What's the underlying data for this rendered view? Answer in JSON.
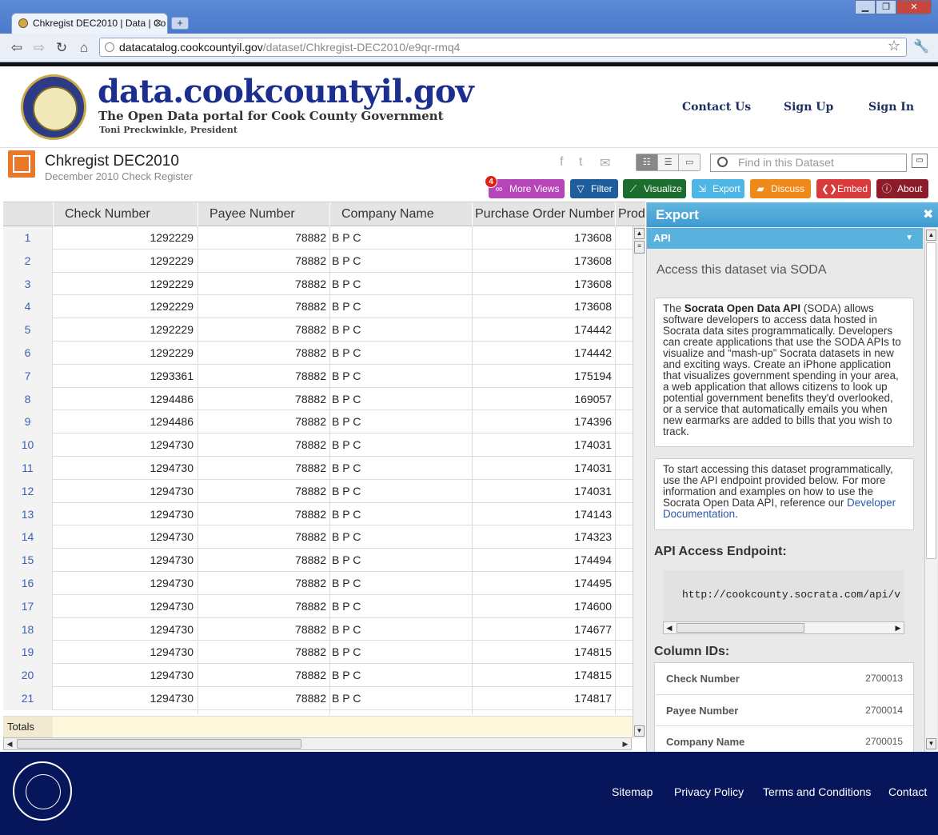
{
  "browser": {
    "tab_title": "Chkregist DEC2010 | Data | Co",
    "url_domain": "datacatalog.cookcountyil.gov",
    "url_path": "/dataset/Chkregist-DEC2010/e9qr-rmq4"
  },
  "site": {
    "name": "data.cookcountyil.gov",
    "tagline": "The Open Data portal for Cook County Government",
    "subline": "Toni Preckwinkle, President",
    "links": [
      "Contact Us",
      "Sign Up",
      "Sign In"
    ]
  },
  "dataset": {
    "title": "Chkregist DEC2010",
    "subtitle": "December 2010 Check Register",
    "search_placeholder": "Find in this Dataset",
    "more_views_count": "4",
    "actions": [
      {
        "label": "More Views",
        "color": "#b545b8"
      },
      {
        "label": "Filter",
        "color": "#1f5e9c"
      },
      {
        "label": "Visualize",
        "color": "#1b6e2e"
      },
      {
        "label": "Export",
        "color": "#4db6e4"
      },
      {
        "label": "Discuss",
        "color": "#ef8a1a"
      },
      {
        "label": "Embed",
        "color": "#d93a3a"
      },
      {
        "label": "About",
        "color": "#8c1c2a"
      }
    ]
  },
  "grid": {
    "columns": [
      "Check Number",
      "Payee Number",
      "Company Name",
      "Purchase Order Number",
      "Prod"
    ],
    "rows": [
      [
        "1",
        "1292229",
        "78882",
        "B P C",
        "173608"
      ],
      [
        "2",
        "1292229",
        "78882",
        "B P C",
        "173608"
      ],
      [
        "3",
        "1292229",
        "78882",
        "B P C",
        "173608"
      ],
      [
        "4",
        "1292229",
        "78882",
        "B P C",
        "173608"
      ],
      [
        "5",
        "1292229",
        "78882",
        "B P C",
        "174442"
      ],
      [
        "6",
        "1292229",
        "78882",
        "B P C",
        "174442"
      ],
      [
        "7",
        "1293361",
        "78882",
        "B P C",
        "175194"
      ],
      [
        "8",
        "1294486",
        "78882",
        "B P C",
        "169057"
      ],
      [
        "9",
        "1294486",
        "78882",
        "B P C",
        "174396"
      ],
      [
        "10",
        "1294730",
        "78882",
        "B P C",
        "174031"
      ],
      [
        "11",
        "1294730",
        "78882",
        "B P C",
        "174031"
      ],
      [
        "12",
        "1294730",
        "78882",
        "B P C",
        "174031"
      ],
      [
        "13",
        "1294730",
        "78882",
        "B P C",
        "174143"
      ],
      [
        "14",
        "1294730",
        "78882",
        "B P C",
        "174323"
      ],
      [
        "15",
        "1294730",
        "78882",
        "B P C",
        "174494"
      ],
      [
        "16",
        "1294730",
        "78882",
        "B P C",
        "174495"
      ],
      [
        "17",
        "1294730",
        "78882",
        "B P C",
        "174600"
      ],
      [
        "18",
        "1294730",
        "78882",
        "B P C",
        "174677"
      ],
      [
        "19",
        "1294730",
        "78882",
        "B P C",
        "174815"
      ],
      [
        "20",
        "1294730",
        "78882",
        "B P C",
        "174815"
      ],
      [
        "21",
        "1294730",
        "78882",
        "B P C",
        "174817"
      ]
    ],
    "totals_label": "Totals"
  },
  "panel": {
    "title": "Export",
    "section": "API",
    "access_heading": "Access this dataset via SODA",
    "soda_pre": "The ",
    "soda_bold": "Socrata Open Data API",
    "soda_post": " (SODA) allows software developers to access data hosted in Socrata data sites programmatically. Developers can create applications that use the SODA APIs to visualize and “mash-up” Socrata datasets in new and exciting ways. Create an iPhone application that visualizes government spending in your area, a web application that allows citizens to look up potential government benefits they'd overlooked, or a service that automatically emails you when new earmarks are added to bills that you wish to track.",
    "start_text": "To start accessing this dataset programmatically, use the API endpoint provided below. For more information and examples on how to use the Socrata Open Data API, reference our ",
    "dev_doc_link": "Developer Documentation",
    "endpoint_heading": "API Access Endpoint:",
    "endpoint_url": "http://cookcounty.socrata.com/api/v",
    "column_ids_heading": "Column IDs:",
    "column_ids": [
      {
        "name": "Check Number",
        "id": "2700013"
      },
      {
        "name": "Payee Number",
        "id": "2700014"
      },
      {
        "name": "Company Name",
        "id": "2700015"
      }
    ]
  },
  "footer": {
    "links": [
      "Sitemap",
      "Privacy Policy",
      "Terms and Conditions",
      "Contact"
    ]
  }
}
